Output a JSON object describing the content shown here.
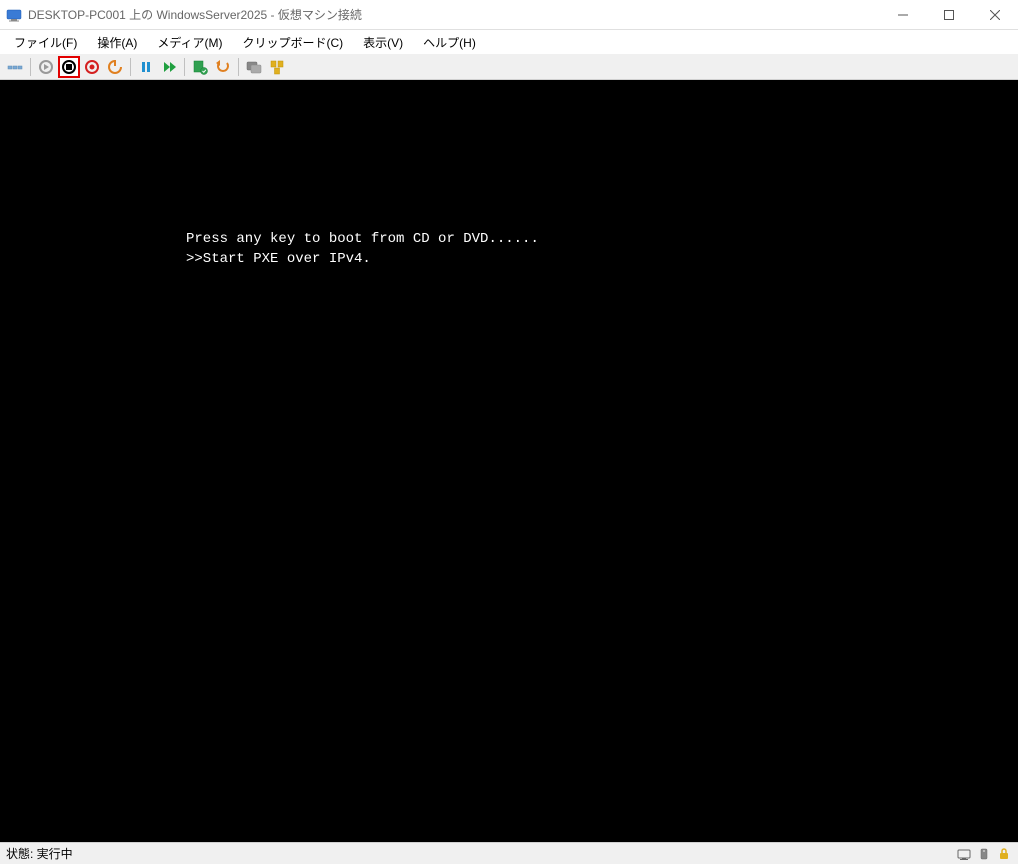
{
  "window": {
    "title": "DESKTOP-PC001 上の WindowsServer2025  - 仮想マシン接続"
  },
  "menu": {
    "file": "ファイル(F)",
    "action": "操作(A)",
    "media": "メディア(M)",
    "clipboard": "クリップボード(C)",
    "view": "表示(V)",
    "help": "ヘルプ(H)"
  },
  "console": {
    "line1": "Press any key to boot from CD or DVD......",
    "line2": ">>Start PXE over IPv4."
  },
  "status": {
    "text": "状態: 実行中"
  }
}
